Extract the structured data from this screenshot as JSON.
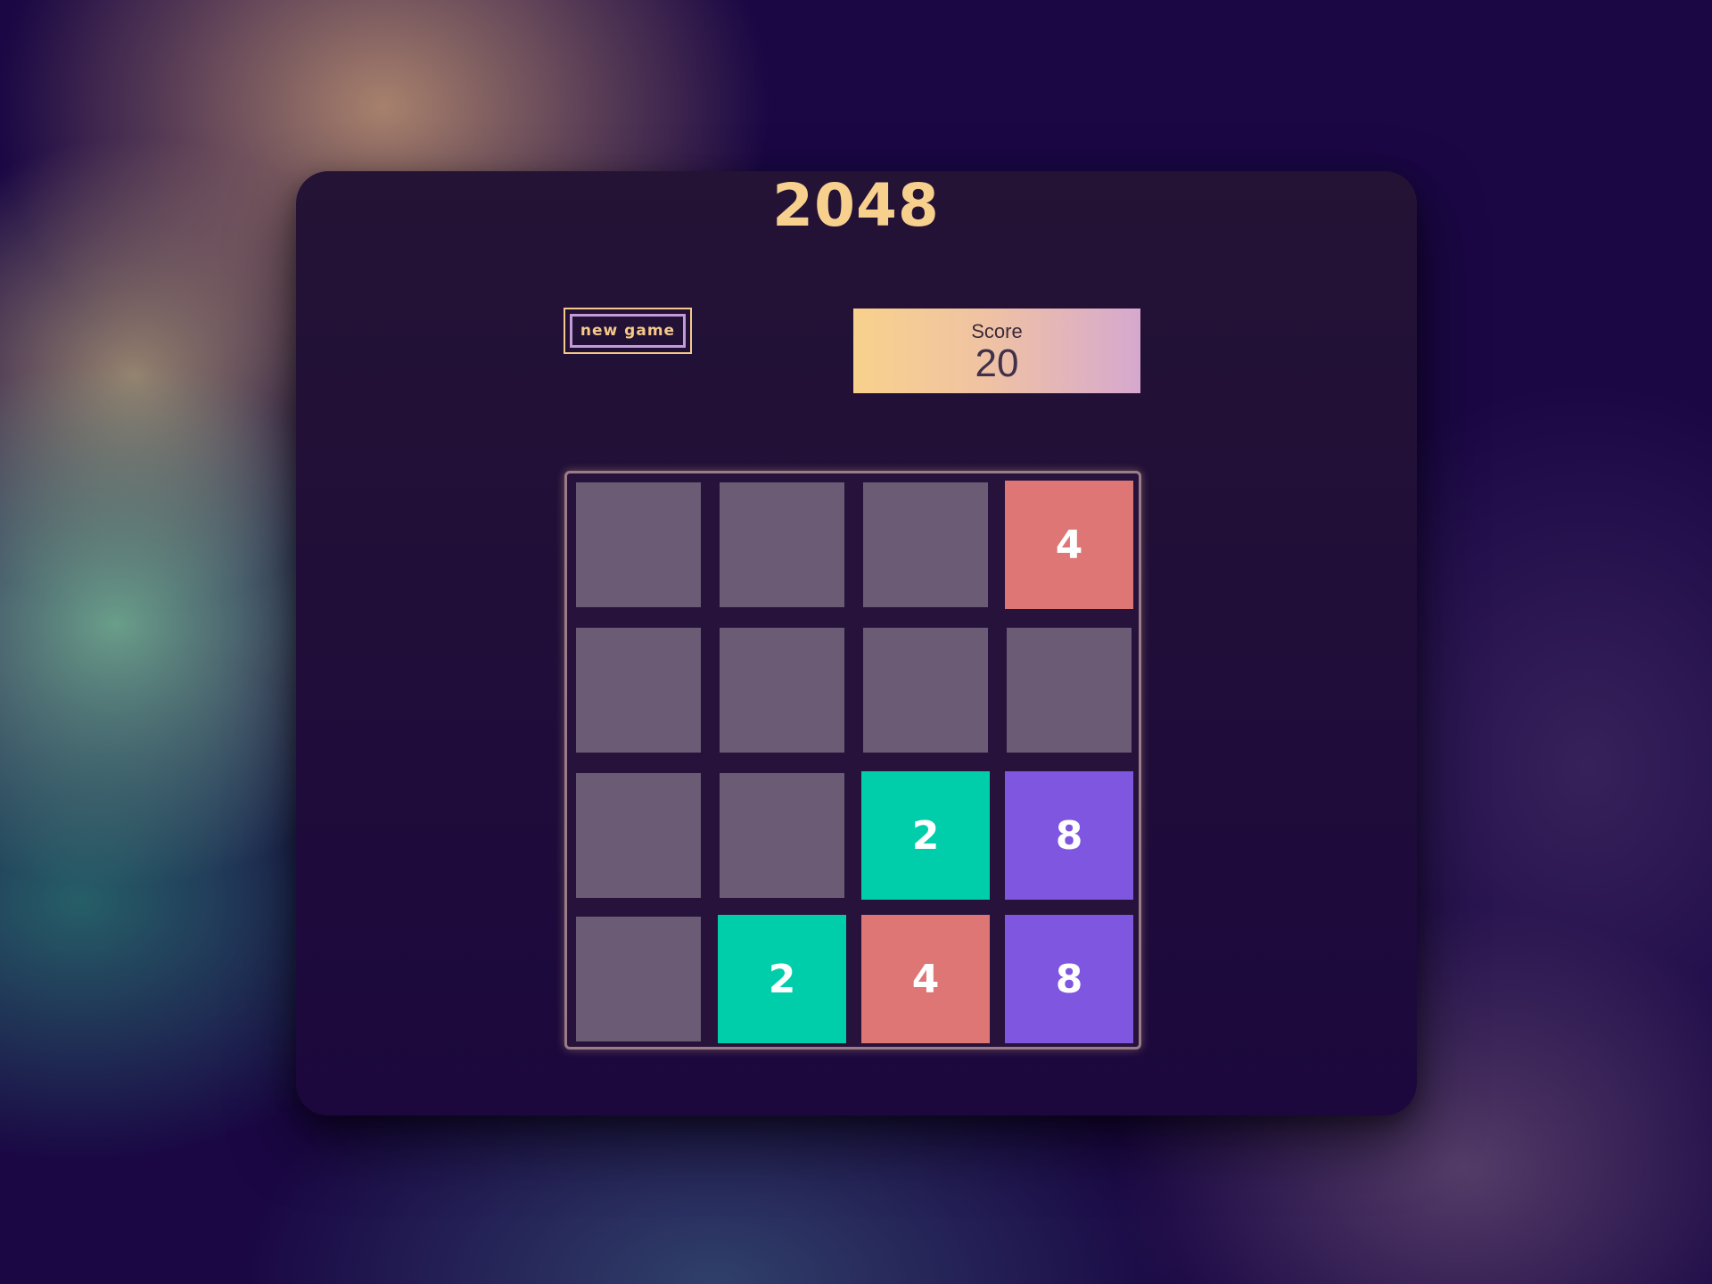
{
  "game": {
    "title": "2048",
    "new_game_label": "new game",
    "score_label": "Score",
    "score_value": "20"
  },
  "colors": {
    "title": "#f8d08e",
    "empty_tile": "#6b5b75",
    "tile_2": "#00ceaa",
    "tile_4": "#de7675",
    "tile_8": "#7f56df",
    "score_gradient_start": "#f8d18c",
    "score_gradient_end": "#d6a8cf"
  },
  "board": {
    "rows": 4,
    "cols": 4,
    "cells": [
      [
        "",
        "",
        "",
        "4"
      ],
      [
        "",
        "",
        "",
        ""
      ],
      [
        "",
        "",
        "2",
        "8"
      ],
      [
        "",
        "2",
        "4",
        "8"
      ]
    ]
  }
}
